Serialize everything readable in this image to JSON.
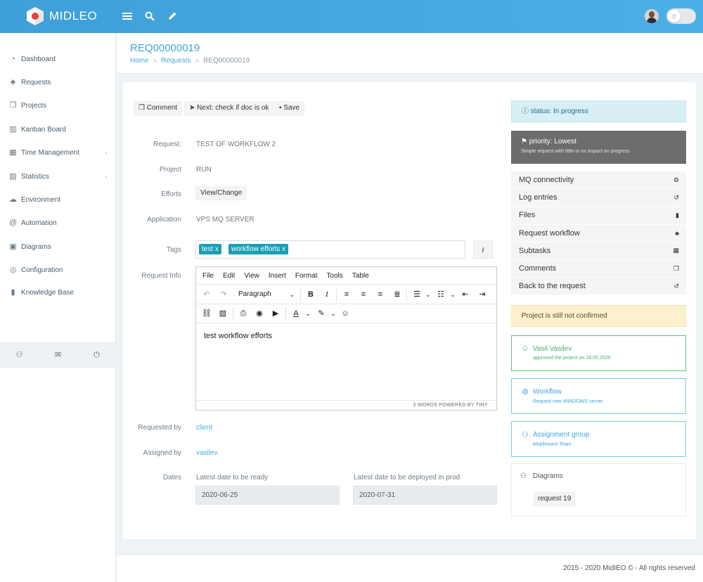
{
  "brand": {
    "name": "MIDLEO"
  },
  "sidebar": {
    "items": [
      {
        "label": "Dashboard",
        "icon": "dashboard-icon"
      },
      {
        "label": "Requests",
        "icon": "sitemap-icon"
      },
      {
        "label": "Projects",
        "icon": "copy-icon"
      },
      {
        "label": "Kanban Board",
        "icon": "kanban-icon"
      },
      {
        "label": "Time Management",
        "icon": "calendar-icon"
      },
      {
        "label": "Statistics",
        "icon": "chart-icon"
      },
      {
        "label": "Environment",
        "icon": "cloud-icon"
      },
      {
        "label": "Automation",
        "icon": "at-icon"
      },
      {
        "label": "Diagrams",
        "icon": "diagram-icon"
      },
      {
        "label": "Configuration",
        "icon": "target-icon"
      },
      {
        "label": "Knowledge Base",
        "icon": "book-icon"
      }
    ]
  },
  "header": {
    "title": "REQ00000019",
    "breadcrumb": [
      "Home",
      "Requests",
      "REQ00000019"
    ]
  },
  "actions": {
    "comment": "Comment",
    "next": "Next: check if doc is ok",
    "save": "Save"
  },
  "form": {
    "request_label": "Request:",
    "request_value": "TEST OF WORKFLOW 2",
    "project_label": "Project",
    "project_value": "RUN",
    "efforts_label": "Efforts",
    "efforts_button": "View/Change",
    "application_label": "Application",
    "application_value": "VPS MQ SERVER",
    "tags_label": "Tags",
    "tags": [
      "test",
      "workflow efforts"
    ],
    "tag_remove": "x",
    "info_button": "i",
    "request_info_label": "Request Info",
    "requested_by_label": "Requested by",
    "requested_by_value": "client",
    "assigned_by_label": "Assigned by",
    "assigned_by_value": "vasilev",
    "dates_label": "Dates",
    "ready_label": "Latest date to be ready",
    "ready_value": "2020-06-25",
    "deploy_label": "Latest date to be deployed in prod",
    "deploy_value": "2020-07-31"
  },
  "editor": {
    "menu": [
      "File",
      "Edit",
      "View",
      "Insert",
      "Format",
      "Tools",
      "Table"
    ],
    "block_format": "Paragraph",
    "content": "test workflow efforts",
    "status": "3 WORDS  POWERED BY TINY"
  },
  "right": {
    "status": "status: In progress",
    "priority_title": "priority: Lowest",
    "priority_desc": "Simple request with little or no impact on progress",
    "list": [
      {
        "label": "MQ connectivity",
        "icon": "cogs-icon"
      },
      {
        "label": "Log entries",
        "icon": "history-icon"
      },
      {
        "label": "Files",
        "icon": "files-icon"
      },
      {
        "label": "Request workflow",
        "icon": "sitemap-icon"
      },
      {
        "label": "Subtasks",
        "icon": "calendar-icon"
      },
      {
        "label": "Comments",
        "icon": "copy-icon"
      },
      {
        "label": "Back to the request",
        "icon": "history-icon"
      }
    ],
    "warning": "Project is still not confirmed",
    "approver_name": "Vasil Vasilev",
    "approver_note": "approved the project on 28.05.2020",
    "workflow_title": "Workflow",
    "workflow_note": "Request new WINDOWS server",
    "group_title": "Assignment group",
    "group_note": "Middleware Team",
    "diagrams_title": "Diagrams",
    "diagram_chip": "request 19"
  },
  "footer": {
    "text": "2015 - 2020 MidIEO © - All rights reserved"
  },
  "colors": {
    "accent": "#3fa6e0",
    "tag": "#1a9fb4",
    "success": "#4cae6b",
    "warning_bg": "#fdf0cf",
    "info_bg": "#d7eef5"
  }
}
